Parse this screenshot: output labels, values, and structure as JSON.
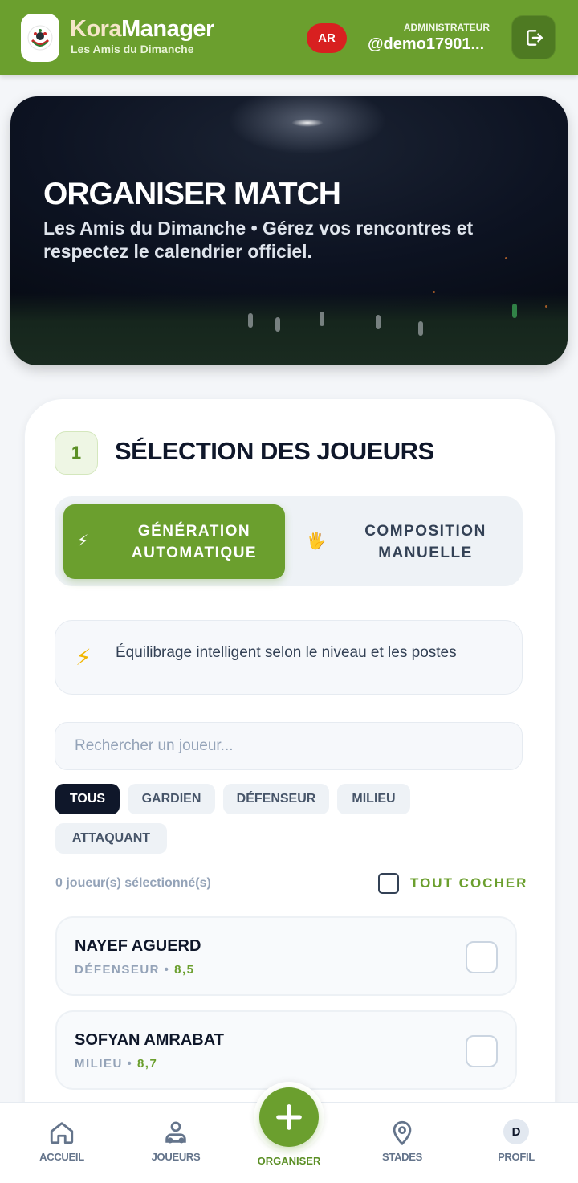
{
  "header": {
    "brand_part1": "Kora",
    "brand_part2": "Manager",
    "club_name": "Les Amis du Dimanche",
    "language": "AR",
    "role": "ADMINISTRATEUR",
    "username": "@demo17901..."
  },
  "hero": {
    "title": "ORGANISER MATCH",
    "subtitle": "Les Amis du Dimanche • Gérez vos rencontres et respectez le calendrier officiel."
  },
  "selection": {
    "step_number": "1",
    "title": "SÉLECTION DES JOUEURS",
    "mode_auto_icon": "⚡",
    "mode_auto_label": "GÉNÉRATION AUTOMATIQUE",
    "mode_manual_icon": "🖐",
    "mode_manual_label": "COMPOSITION MANUELLE",
    "info_icon": "⚡",
    "info_text": "Équilibrage intelligent selon le niveau et les postes",
    "search_placeholder": "Rechercher un joueur...",
    "filters": [
      "TOUS",
      "GARDIEN",
      "DÉFENSEUR",
      "MILIEU",
      "ATTAQUANT"
    ],
    "selected_count_text": "0 joueur(s) sélectionné(s)",
    "check_all_label": "TOUT COCHER",
    "players": [
      {
        "name": "NAYEF AGUERD",
        "position": "DÉFENSEUR",
        "rating": "8,5"
      },
      {
        "name": "SOFYAN AMRABAT",
        "position": "MILIEU",
        "rating": "8,7"
      }
    ]
  },
  "nav": {
    "home": "ACCUEIL",
    "players": "JOUEURS",
    "organize": "ORGANISER",
    "stadiums": "STADES",
    "profile": "PROFIL",
    "profile_initial": "D"
  },
  "colors": {
    "primary": "#6b9f2e",
    "dark": "#0f172a",
    "lang_badge": "#d82020"
  }
}
